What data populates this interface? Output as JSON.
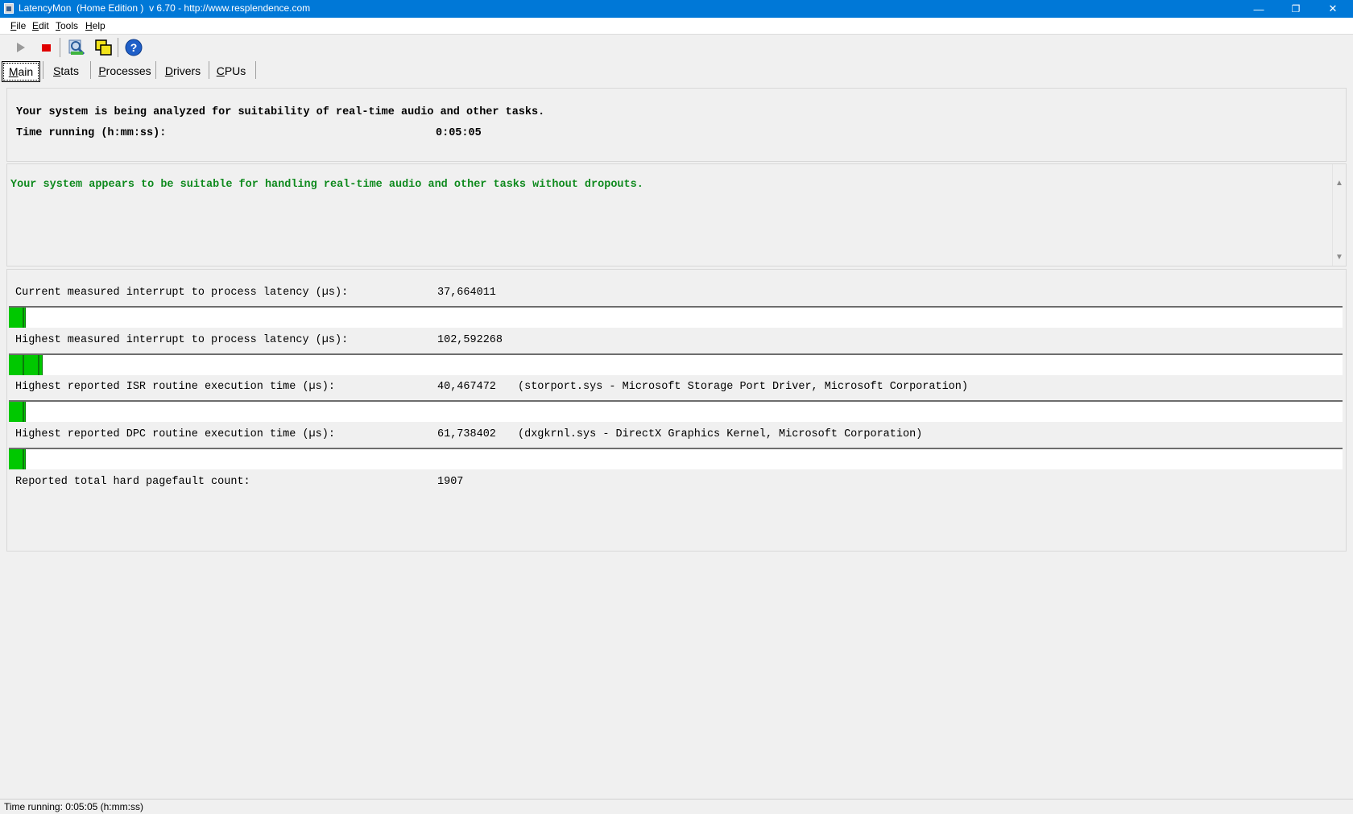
{
  "window": {
    "title": "LatencyMon  (Home Edition )  v 6.70 - http://www.resplendence.com",
    "controls": {
      "minimize": "—",
      "restore": "❐",
      "close": "✕"
    }
  },
  "menu": [
    "File",
    "Edit",
    "Tools",
    "Help"
  ],
  "toolbar": {
    "buttons": [
      {
        "icon": "play-icon"
      },
      {
        "icon": "stop-icon"
      },
      {
        "icon": "analyze-icon"
      },
      {
        "icon": "copy-windows-icon"
      },
      {
        "icon": "help-icon"
      }
    ]
  },
  "tabs": [
    {
      "label": "Main",
      "active": true
    },
    {
      "label": "Stats",
      "active": false
    },
    {
      "label": "Processes",
      "active": false
    },
    {
      "label": "Drivers",
      "active": false
    },
    {
      "label": "CPUs",
      "active": false
    }
  ],
  "header": {
    "line1": "Your system is being analyzed for suitability of real-time audio and other tasks.",
    "time_label": "Time running (h:mm:ss):",
    "time_value": "0:05:05"
  },
  "verdict": {
    "text": "Your system appears to be suitable for handling real-time audio and other tasks without dropouts.",
    "color": "#0f8a1e"
  },
  "metrics": [
    {
      "label": "Current measured interrupt to process latency (µs):",
      "value": "37,664011",
      "detail": "",
      "bar_fraction": 0.012
    },
    {
      "label": "Highest measured interrupt to process latency (µs):",
      "value": "102,592268",
      "detail": "",
      "bar_fraction": 0.025
    },
    {
      "label": "Highest reported ISR routine execution time (µs):",
      "value": "40,467472",
      "detail": "(storport.sys - Microsoft Storage Port Driver, Microsoft Corporation)",
      "bar_fraction": 0.012
    },
    {
      "label": "Highest reported DPC routine execution time (µs):",
      "value": "61,738402",
      "detail": "(dxgkrnl.sys - DirectX Graphics Kernel, Microsoft Corporation)",
      "bar_fraction": 0.012
    }
  ],
  "pagefault": {
    "label": "Reported total hard pagefault count:",
    "value": "1907"
  },
  "statusbar": {
    "text": "Time running: 0:05:05  (h:mm:ss)"
  }
}
